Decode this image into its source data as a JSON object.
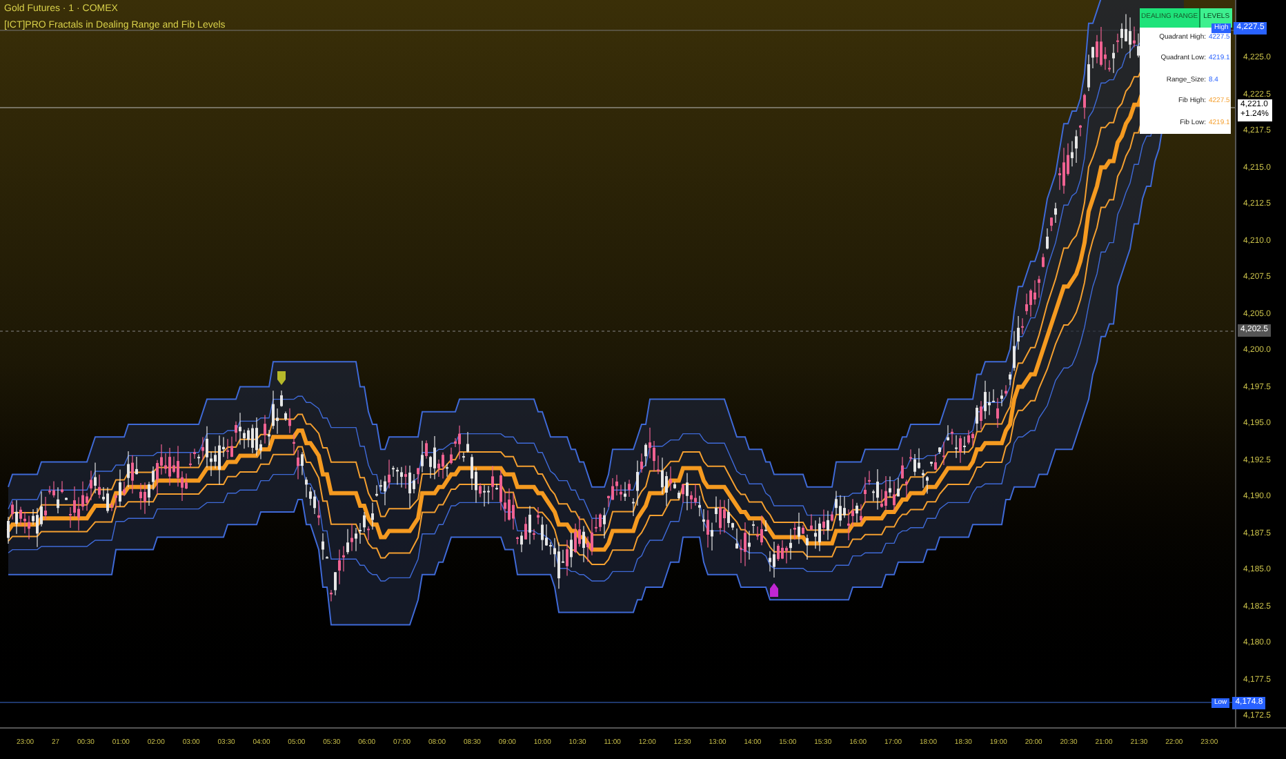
{
  "legend": {
    "symbol": "Gold Futures · 1 · COMEX",
    "indicator": "[ICT]PRO Fractals in Dealing Range and Fib Levels"
  },
  "range_table": {
    "header": [
      "DEALING RANGE",
      "LEVELS"
    ],
    "rows": [
      {
        "label": "Quadrant High:",
        "value": "4227.5",
        "kind": "quadrant"
      },
      {
        "label": "Quadrant Low:",
        "value": "4219.1",
        "kind": "quadrant"
      },
      {
        "label": "Range_Size:",
        "value": "8.4",
        "kind": "quadrant"
      },
      {
        "label": "Fib High:",
        "value": "4227.5",
        "kind": "fib"
      },
      {
        "label": "Fib Low:",
        "value": "4219.1",
        "kind": "fib"
      }
    ]
  },
  "price_axis": {
    "ticks": [
      "4,225.0",
      "4,222.5",
      "4,217.5",
      "4,215.0",
      "4,212.5",
      "4,210.0",
      "4,207.5",
      "4,205.0",
      "4,200.0",
      "4,197.5",
      "4,195.0",
      "4,192.5",
      "4,190.0",
      "4,187.5",
      "4,185.0",
      "4,182.5",
      "4,180.0",
      "4,177.5",
      "4,172.5"
    ],
    "badges": [
      {
        "kind": "high",
        "tag": "High",
        "value": "4,227.5"
      },
      {
        "kind": "price",
        "value": "4,221.0",
        "change": "+1.24%"
      },
      {
        "kind": "crosshair",
        "value": "4,202.5"
      },
      {
        "kind": "low",
        "tag": "Low",
        "value": "4,174.8"
      }
    ]
  },
  "time_axis": {
    "labels": [
      "23:00",
      "27",
      "00:30",
      "01:00",
      "02:00",
      "03:00",
      "03:30",
      "04:00",
      "05:00",
      "05:30",
      "06:00",
      "07:00",
      "08:00",
      "08:30",
      "09:00",
      "10:00",
      "10:30",
      "11:00",
      "12:00",
      "12:30",
      "13:00",
      "14:00",
      "15:00",
      "15:30",
      "16:00",
      "17:00",
      "18:00",
      "18:30",
      "19:00",
      "20:00",
      "20:30",
      "21:00",
      "21:30",
      "22:00",
      "23:00"
    ]
  }
}
